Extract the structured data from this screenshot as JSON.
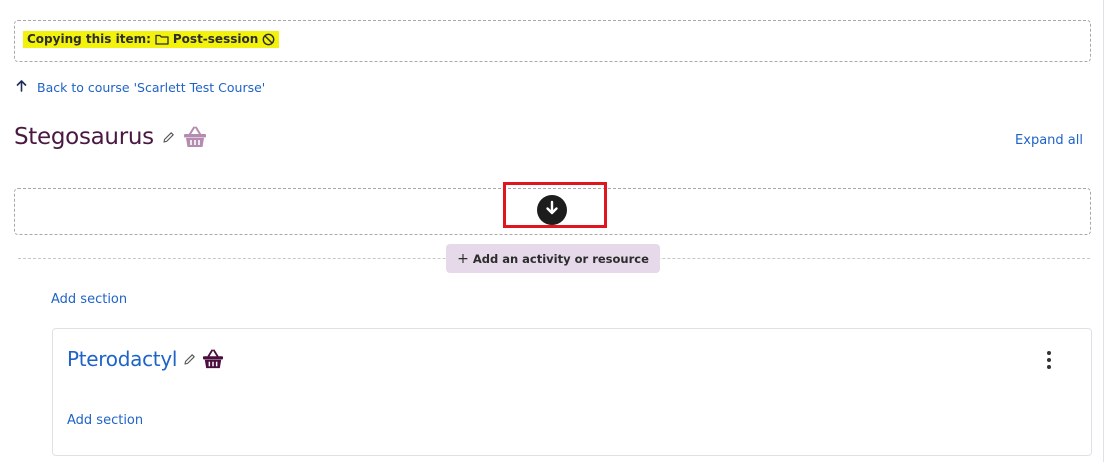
{
  "copy_banner": {
    "prefix": "Copying this item:",
    "item_name": "Post-session",
    "folder_icon": "folder-icon",
    "cancel_icon": "cancel-icon"
  },
  "back_link": {
    "label": "Back to course 'Scarlett Test Course'",
    "icon": "arrow-up-icon"
  },
  "section": {
    "title": "Stegosaurus",
    "expand_label": "Expand all"
  },
  "drop_zone": {
    "icon": "arrow-down-circle-icon"
  },
  "add_activity": {
    "plus": "+",
    "label": "Add an activity or resource"
  },
  "add_section_label": "Add section",
  "subsection": {
    "title": "Pterodactyl",
    "add_section_label": "Add section"
  },
  "colors": {
    "highlight_yellow": "#f2f20c",
    "link_blue": "#1e63c8",
    "title_purple": "#4a1942",
    "basket_light": "#b48cb0",
    "basket_dark": "#4a0f3f",
    "outline_red": "#e0161e",
    "add_button_bg": "#e5d9ea"
  }
}
